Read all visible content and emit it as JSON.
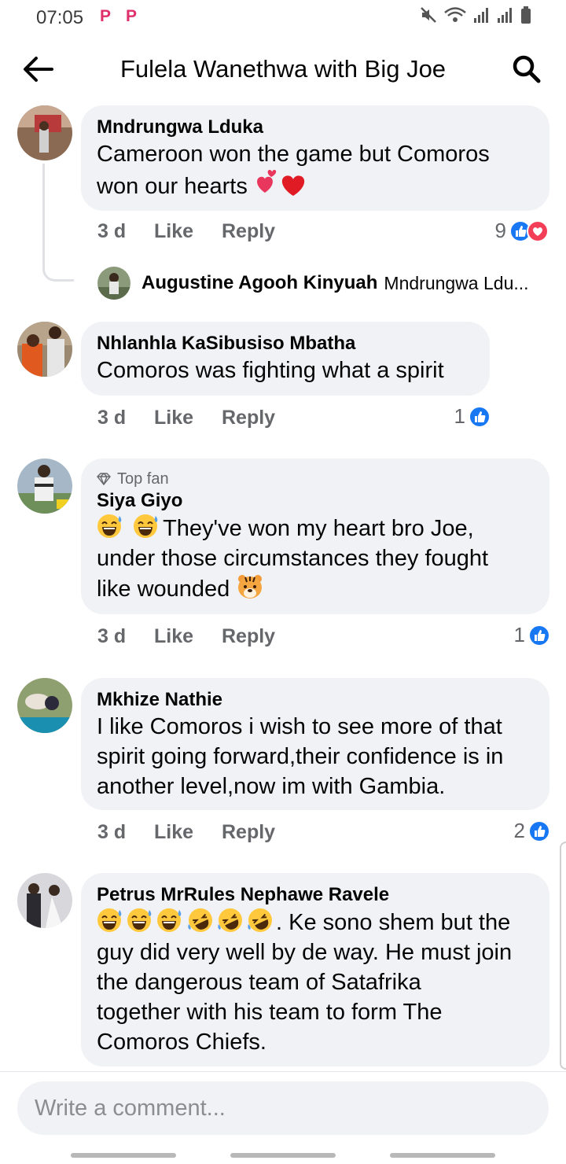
{
  "status": {
    "time": "07:05",
    "app_glyph_1": "P",
    "app_glyph_2": "P"
  },
  "header": {
    "title": "Fulela Wanethwa with Big Joe",
    "back_icon": "arrow-left-icon",
    "search_icon": "search-icon"
  },
  "comments": [
    {
      "author": "Mndrungwa Lduka",
      "text_lines": [
        "Cameroon won the game but Comoros",
        "won our hearts"
      ],
      "time": "3 d",
      "like_label": "Like",
      "reply_label": "Reply",
      "reaction_count": "9",
      "reactions": [
        "like",
        "love"
      ]
    },
    {
      "author": "Nhlanhla KaSibusiso Mbatha",
      "text_lines": [
        "Comoros was fighting what a spirit"
      ],
      "time": "3 d",
      "like_label": "Like",
      "reply_label": "Reply",
      "reaction_count": "1",
      "reactions": [
        "like"
      ]
    },
    {
      "badge": "Top fan",
      "author": "Siya Giyo",
      "text_lines": [
        "They've won my heart bro Joe,",
        "under those circumstances they fought",
        "like wounded"
      ],
      "time": "3 d",
      "like_label": "Like",
      "reply_label": "Reply",
      "reaction_count": "1",
      "reactions": [
        "like"
      ]
    },
    {
      "author": "Mkhize Nathie",
      "text_lines": [
        "I like Comoros i wish to see more of that",
        "spirit going forward,their confidence is in",
        "another level,now im with Gambia."
      ],
      "time": "3 d",
      "like_label": "Like",
      "reply_label": "Reply",
      "reaction_count": "2",
      "reactions": [
        "like"
      ]
    },
    {
      "author": "Petrus MrRules Nephawe Ravele",
      "text_lines": [
        ". Ke sono shem but the",
        "guy did very well by de way. He must join",
        "the dangerous team of Satafrika",
        "together with his team to form The",
        "Comoros Chiefs."
      ]
    }
  ],
  "reply_preview": {
    "author": "Augustine Agooh Kinyuah",
    "snippet": "Mndrungwa Ldu..."
  },
  "composer": {
    "placeholder": "Write a comment..."
  },
  "colors": {
    "like_blue": "#1877f2",
    "love_red": "#f33e58",
    "bubble_bg": "#f0f2f5",
    "meta_grey": "#65676b"
  }
}
